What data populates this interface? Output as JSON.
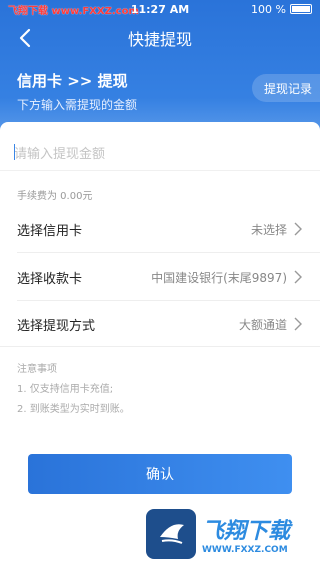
{
  "status_bar": {
    "watermark": "飞翔下载 www.FXXZ.com",
    "time": "11:27 AM",
    "battery": "100 %"
  },
  "nav": {
    "title": "快捷提现"
  },
  "header": {
    "section_title": "信用卡 >> 提现",
    "subtitle": "下方输入需提现的金额",
    "record_button": "提现记录"
  },
  "form": {
    "amount_placeholder": "请输入提现金额",
    "fee_text": "手续费为 0.00元",
    "rows": [
      {
        "label": "选择信用卡",
        "value": "未选择"
      },
      {
        "label": "选择收款卡",
        "value": "中国建设银行(末尾9897)"
      },
      {
        "label": "选择提现方式",
        "value": "大额通道"
      }
    ]
  },
  "notes": {
    "title": "注意事项",
    "items": [
      "1. 仅支持信用卡充值;",
      "2. 到账类型为实时到账。"
    ]
  },
  "confirm_button": "确认",
  "watermark": {
    "big": "飞翔下载",
    "small": "WWW.FXXZ.COM"
  },
  "colors": {
    "primary": "#2a73d9",
    "accent": "#3a86e6"
  }
}
